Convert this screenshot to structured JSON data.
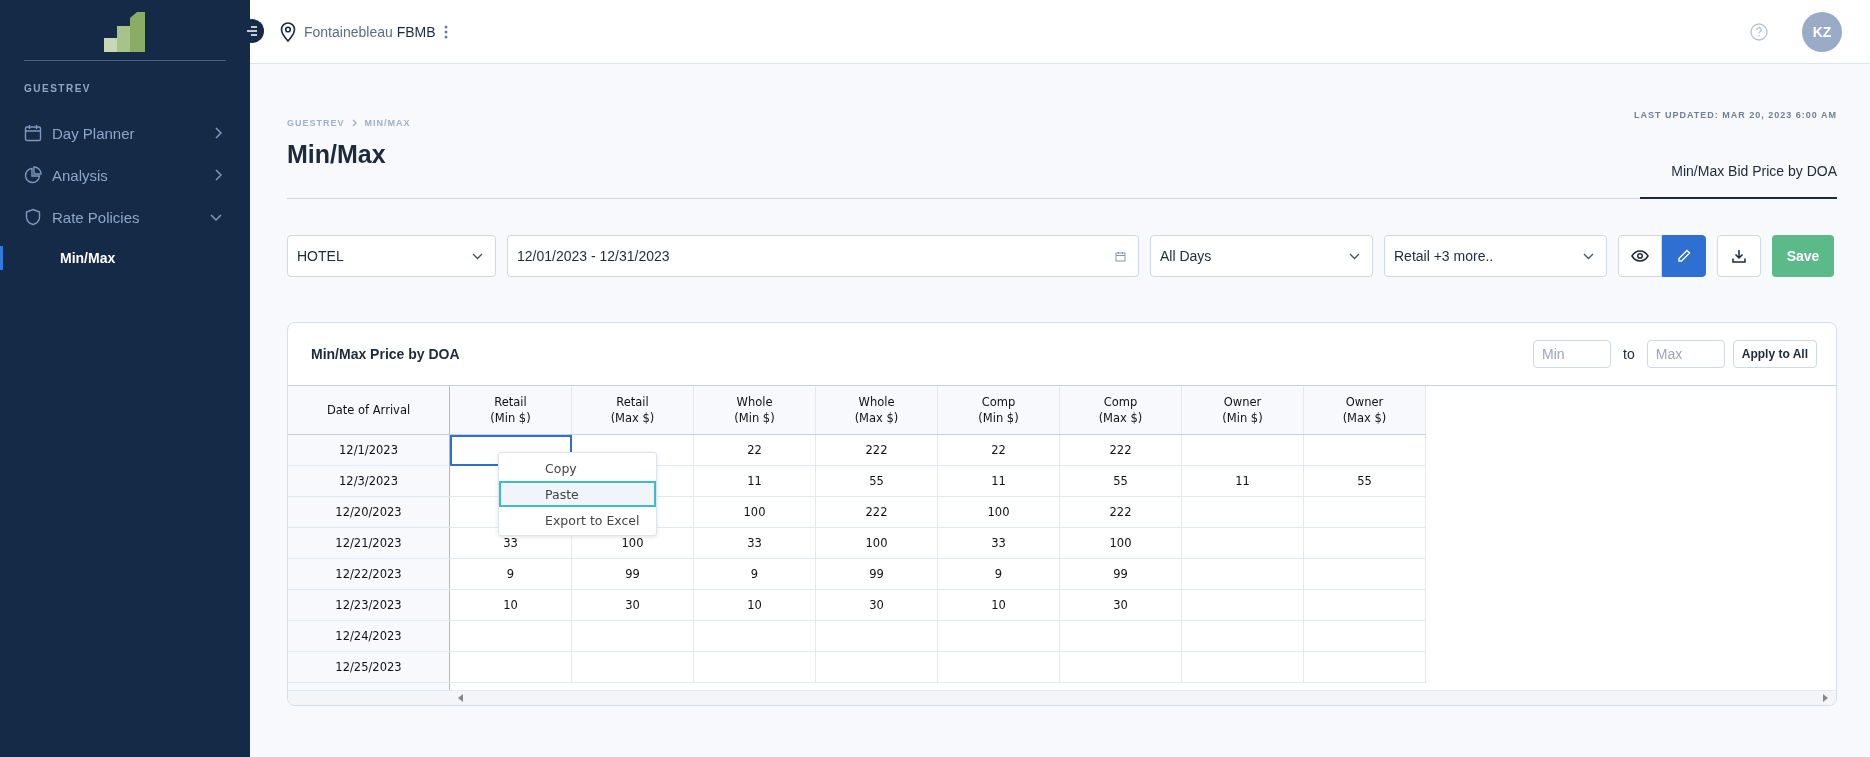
{
  "sidebar": {
    "section": "GUESTREV",
    "items": [
      {
        "label": "Day Planner",
        "expanded": false
      },
      {
        "label": "Analysis",
        "expanded": false
      },
      {
        "label": "Rate Policies",
        "expanded": true,
        "children": [
          {
            "label": "Min/Max",
            "selected": true
          }
        ]
      }
    ]
  },
  "topbar": {
    "location": "Fontainebleau",
    "code": "FBMB",
    "avatar": "KZ"
  },
  "breadcrumb": [
    "GUESTREV",
    "MIN/MAX"
  ],
  "title": "Min/Max",
  "last_updated": "LAST UPDATED: MAR 20, 2023 6:00 AM",
  "tabs": [
    {
      "label": "Min/Max Bid Price by DOA",
      "selected": true
    }
  ],
  "filters": {
    "property": "HOTEL",
    "date_range": "12/01/2023 - 12/31/2023",
    "days": "All Days",
    "rate_types": "Retail +3 more..",
    "view_selected": false,
    "edit_selected": true,
    "save": "Save"
  },
  "card": {
    "title": "Min/Max Price by DOA",
    "min_placeholder": "Min",
    "to": "to",
    "max_placeholder": "Max",
    "apply": "Apply to All"
  },
  "table": {
    "columns": [
      "Date of Arrival",
      "Retail\n(Min $)",
      "Retail\n(Max $)",
      "Whole\n(Min $)",
      "Whole\n(Max $)",
      "Comp\n(Min $)",
      "Comp\n(Max $)",
      "Owner\n(Min $)",
      "Owner\n(Max $)"
    ],
    "rows": [
      {
        "cells": [
          {
            "value": "12/1/2023",
            "selected": false
          },
          {
            "selected": true
          },
          {
            "selected": false
          },
          {
            "value": "22",
            "selected": false
          },
          {
            "value": "222",
            "selected": false
          },
          {
            "value": "22",
            "selected": false
          },
          {
            "value": "222",
            "selected": false
          },
          {
            "selected": false
          },
          {
            "selected": false
          }
        ]
      },
      {
        "cells": [
          {
            "value": "12/3/2023",
            "selected": false
          },
          {
            "selected": false
          },
          {
            "selected": false
          },
          {
            "value": "11",
            "selected": false
          },
          {
            "value": "55",
            "selected": false
          },
          {
            "value": "11",
            "selected": false
          },
          {
            "value": "55",
            "selected": false
          },
          {
            "value": "11",
            "selected": false
          },
          {
            "value": "55",
            "selected": false
          }
        ]
      },
      {
        "cells": [
          {
            "value": "12/20/2023",
            "selected": false
          },
          {
            "selected": false
          },
          {
            "selected": false
          },
          {
            "value": "100",
            "selected": false
          },
          {
            "value": "222",
            "selected": false
          },
          {
            "value": "100",
            "selected": false
          },
          {
            "value": "222",
            "selected": false
          },
          {
            "selected": false
          },
          {
            "selected": false
          }
        ]
      },
      {
        "cells": [
          {
            "value": "12/21/2023",
            "selected": false
          },
          {
            "value": "33",
            "selected": false
          },
          {
            "value": "100",
            "selected": false
          },
          {
            "value": "33",
            "selected": false
          },
          {
            "value": "100",
            "selected": false
          },
          {
            "value": "33",
            "selected": false
          },
          {
            "value": "100",
            "selected": false
          },
          {
            "selected": false
          },
          {
            "selected": false
          }
        ]
      },
      {
        "cells": [
          {
            "value": "12/22/2023",
            "selected": false
          },
          {
            "value": "9",
            "selected": false
          },
          {
            "value": "99",
            "selected": false
          },
          {
            "value": "9",
            "selected": false
          },
          {
            "value": "99",
            "selected": false
          },
          {
            "value": "9",
            "selected": false
          },
          {
            "value": "99",
            "selected": false
          },
          {
            "selected": false
          },
          {
            "selected": false
          }
        ]
      },
      {
        "cells": [
          {
            "value": "12/23/2023",
            "selected": false
          },
          {
            "value": "10",
            "selected": false
          },
          {
            "value": "30",
            "selected": false
          },
          {
            "value": "10",
            "selected": false
          },
          {
            "value": "30",
            "selected": false
          },
          {
            "value": "10",
            "selected": false
          },
          {
            "value": "30",
            "selected": false
          },
          {
            "selected": false
          },
          {
            "selected": false
          }
        ]
      },
      {
        "cells": [
          {
            "value": "12/24/2023",
            "selected": false
          },
          {
            "selected": false
          },
          {
            "selected": false
          },
          {
            "selected": false
          },
          {
            "selected": false
          },
          {
            "selected": false
          },
          {
            "selected": false
          },
          {
            "selected": false
          },
          {
            "selected": false
          }
        ]
      },
      {
        "cells": [
          {
            "value": "12/25/2023",
            "selected": false
          },
          {
            "selected": false
          },
          {
            "selected": false
          },
          {
            "selected": false
          },
          {
            "selected": false
          },
          {
            "selected": false
          },
          {
            "selected": false
          },
          {
            "selected": false
          },
          {
            "selected": false
          }
        ]
      }
    ]
  },
  "context_menu": [
    {
      "label": "Copy",
      "selected": false
    },
    {
      "label": "Paste",
      "selected": true
    },
    {
      "label": "Export to Excel",
      "selected": false
    }
  ]
}
